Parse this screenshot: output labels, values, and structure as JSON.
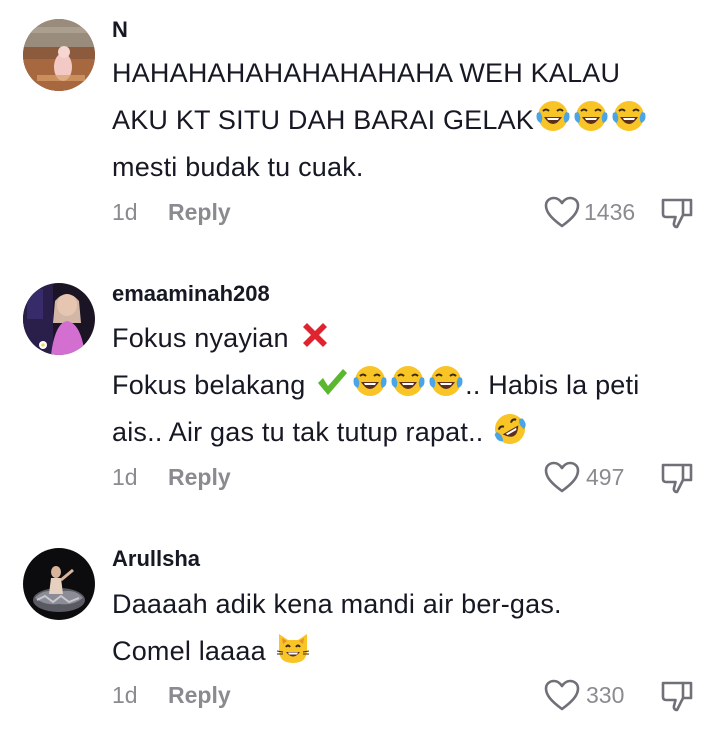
{
  "comments": [
    {
      "username": "N",
      "avatar": "avatar-photo",
      "lines": [
        "HAHAHAHAHAHAHAHAHA WEH KALAU",
        "AKU KT SITU DAH BARAI GELAK",
        "mesti budak tu cuak."
      ],
      "emojis": [
        "face-with-tears-of-joy",
        "face-with-tears-of-joy",
        "face-with-tears-of-joy",
        "cross-mark",
        "check-mark",
        "rolling-on-the-floor-laughing",
        "grinning-cat"
      ],
      "time": "1d",
      "reply_label": "Reply",
      "likes": "1436"
    },
    {
      "username": "emaaminah208",
      "avatar": "avatar-photo",
      "lines": [
        "Fokus nyayian",
        "Fokus belakang",
        ".. Habis la peti",
        "ais.. Air gas tu tak tutup rapat.."
      ],
      "time": "1d",
      "reply_label": "Reply",
      "likes": "497"
    },
    {
      "username": "Arullsha",
      "avatar": "avatar-photo",
      "lines": [
        "Daaaah adik kena mandi air ber-gas.",
        "Comel laaaa"
      ],
      "time": "1d",
      "reply_label": "Reply",
      "likes": "330"
    }
  ],
  "icons": {
    "like": "heart-outline-icon",
    "dislike": "thumbs-down-icon"
  },
  "colors": {
    "text": "#161823",
    "muted": "#8a8b91",
    "emoji_yellow": "#f9c425",
    "tear_blue": "#4aa5e8",
    "cross_red": "#e0242f",
    "check_green": "#5ab72e"
  }
}
